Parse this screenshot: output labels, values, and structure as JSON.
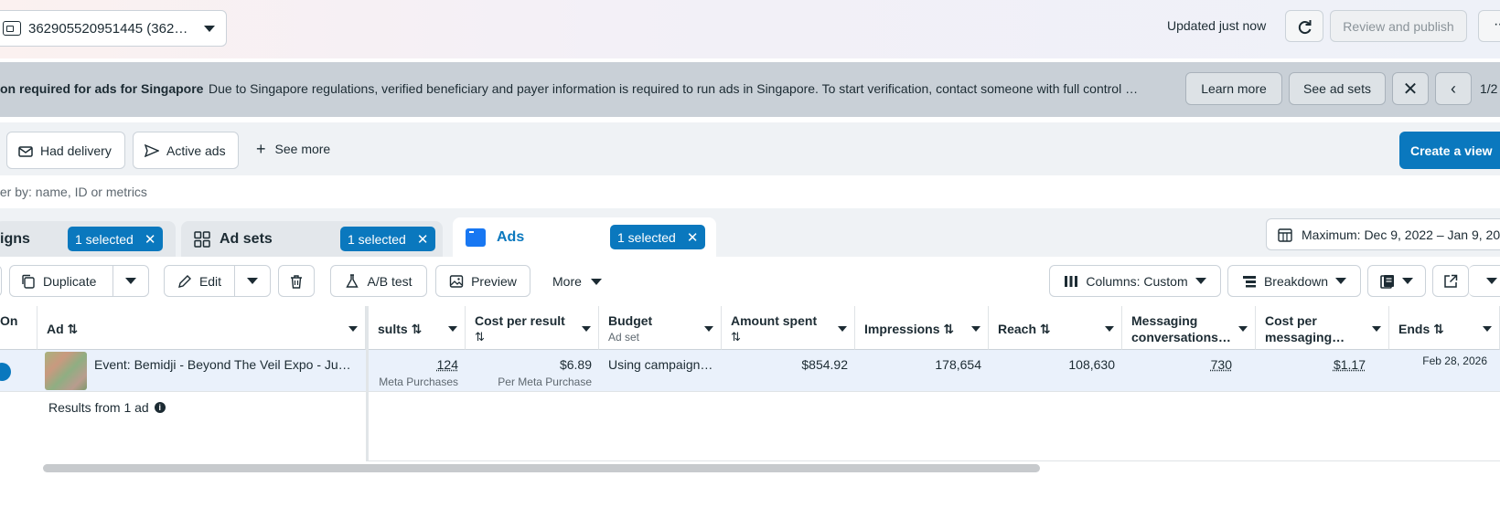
{
  "topbar": {
    "account_label": "362905520951445 (362…",
    "updated_text": "Updated just now",
    "review_label": "Review and publish",
    "more_label": "···"
  },
  "banner": {
    "title": "on required for ads for Singapore",
    "message": "Due to Singapore regulations, verified beneficiary and payer information is required to run ads in Singapore. To start verification, contact someone with full control …",
    "learn_more": "Learn more",
    "see_ad_sets": "See ad sets",
    "close": "✕",
    "prev": "‹",
    "page": "1/2"
  },
  "filters": {
    "had_delivery": "Had delivery",
    "active_ads": "Active ads",
    "see_more": "See more",
    "create_view": "Create a view"
  },
  "search": {
    "placeholder": "ter by: name, ID or metrics"
  },
  "tabs": {
    "campaigns": {
      "label": "igns",
      "badge": "1 selected"
    },
    "adsets": {
      "label": "Ad sets",
      "badge": "1 selected"
    },
    "ads": {
      "label": "Ads",
      "badge": "1 selected"
    },
    "date_range": "Maximum: Dec 9, 2022 – Jan 9, 20"
  },
  "toolbar": {
    "duplicate": "Duplicate",
    "edit": "Edit",
    "ab_test": "A/B test",
    "preview": "Preview",
    "more": "More",
    "columns": "Columns: Custom",
    "breakdown": "Breakdown"
  },
  "table": {
    "headers": {
      "onoff": "On",
      "ad": "Ad ⇅",
      "results": "sults ⇅",
      "cost_per_result": "Cost per result",
      "cost_per_result_sort": "⇅",
      "budget": "Budget",
      "budget_sub": "Ad set",
      "amount_spent": "Amount spent",
      "amount_spent_sort": "⇅",
      "impressions": "Impressions ⇅",
      "reach": "Reach ⇅",
      "messaging": "Messaging",
      "messaging_sub": "conversations…",
      "cost_per_messaging": "Cost per",
      "cost_per_messaging_sub": "messaging…",
      "ends": "Ends ⇅"
    },
    "row": {
      "ad_name": "Event: Bemidji - Beyond The Veil Expo - Ju…",
      "results": "124",
      "results_sub": "Meta Purchases",
      "cost_per_result": "$6.89",
      "cost_per_result_sub": "Per Meta Purchase",
      "budget": "Using campaign…",
      "amount_spent": "$854.92",
      "impressions": "178,654",
      "reach": "108,630",
      "messaging": "730",
      "cost_per_messaging": "$1.17",
      "ends": "Feb 28, 2026"
    },
    "summary": "Results from 1 ad"
  },
  "icons": {
    "refresh": "refresh-icon",
    "account": "ad-account-icon",
    "envelope": "envelope-icon",
    "send": "send-icon",
    "plus": "plus-icon",
    "grid": "grid-icon",
    "calendar": "calendar-icon",
    "info": "info-icon"
  },
  "colors": {
    "accent": "#0a78be",
    "banner_bg": "#c9d0d7",
    "selected_row": "#eaf1fb"
  }
}
